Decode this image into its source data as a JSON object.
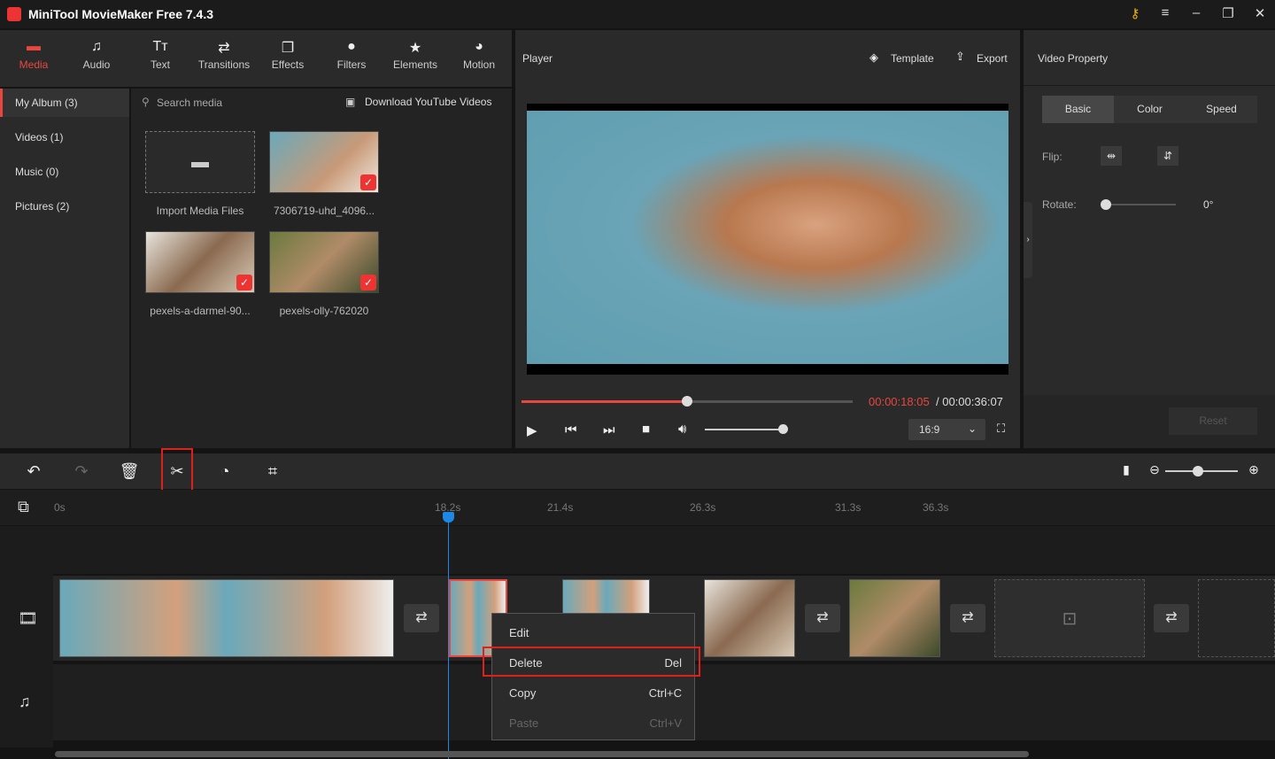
{
  "app": {
    "title": "MiniTool MovieMaker Free 7.4.3"
  },
  "tabs": [
    {
      "label": "Media",
      "icon": "folder-icon",
      "glyph": "▬"
    },
    {
      "label": "Audio",
      "icon": "music-icon",
      "glyph": "♫"
    },
    {
      "label": "Text",
      "icon": "text-icon",
      "glyph": "Tт"
    },
    {
      "label": "Transitions",
      "icon": "transitions-icon",
      "glyph": "⇄"
    },
    {
      "label": "Effects",
      "icon": "effects-icon",
      "glyph": "❐"
    },
    {
      "label": "Filters",
      "icon": "filters-icon",
      "glyph": "●"
    },
    {
      "label": "Elements",
      "icon": "elements-icon",
      "glyph": "★"
    },
    {
      "label": "Motion",
      "icon": "motion-icon",
      "glyph": "◕"
    }
  ],
  "sidebar": [
    {
      "label": "My Album (3)"
    },
    {
      "label": "Videos (1)"
    },
    {
      "label": "Music (0)"
    },
    {
      "label": "Pictures (2)"
    }
  ],
  "media": {
    "search_placeholder": "Search media",
    "download": "Download YouTube Videos",
    "import": "Import Media Files",
    "items": [
      "7306719-uhd_4096...",
      "pexels-a-darmel-90...",
      "pexels-olly-762020"
    ]
  },
  "player": {
    "title": "Player",
    "template": "Template",
    "export": "Export",
    "current": "00:00:18:05",
    "total": " / 00:00:36:07",
    "aspect": "16:9",
    "progress": 0.5,
    "volume": 0.9
  },
  "property": {
    "title": "Video Property",
    "tabs": [
      "Basic",
      "Color",
      "Speed"
    ],
    "flip": "Flip:",
    "rotate": "Rotate:",
    "rotate_value": "0°",
    "reset": "Reset"
  },
  "timeline": {
    "ticks": [
      "0s",
      "18.2s",
      "21.4s",
      "26.3s",
      "31.3s",
      "36.3s"
    ]
  },
  "menu": [
    {
      "label": "Edit",
      "shortcut": ""
    },
    {
      "label": "Delete",
      "shortcut": "Del"
    },
    {
      "label": "Copy",
      "shortcut": "Ctrl+C"
    },
    {
      "label": "Paste",
      "shortcut": "Ctrl+V"
    }
  ],
  "colors": {
    "accent": "#e8473f",
    "playhead": "#1e88e5"
  }
}
